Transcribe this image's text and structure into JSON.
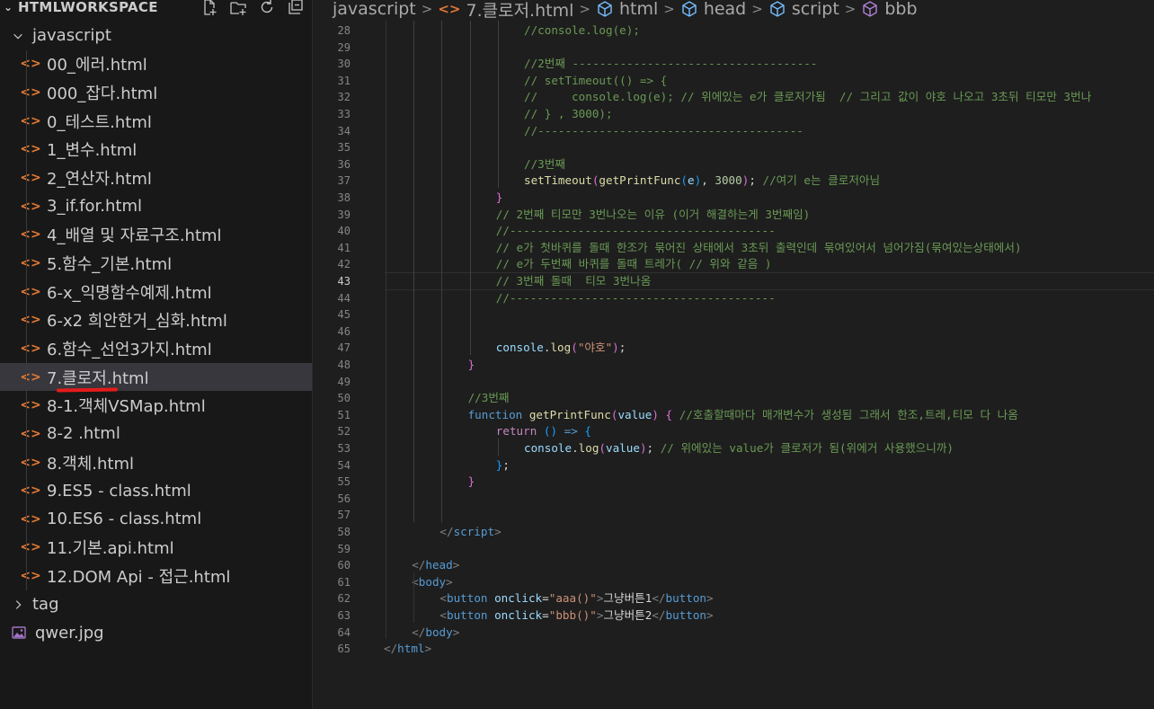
{
  "explorer": {
    "title": "HTMLWORKSPACE",
    "actions": [
      "new-file-icon",
      "new-folder-icon",
      "refresh-icon",
      "collapse-all-icon"
    ],
    "folder_open": "javascript",
    "files": [
      "00_에러.html",
      "000_잡다.html",
      "0_테스트.html",
      "1_변수.html",
      "2_연산자.html",
      "3_if.for.html",
      "4_배열 및 자료구조.html",
      "5.함수_기본.html",
      "6-x_익명함수예제.html",
      "6-x2 희안한거_심화.html",
      "6.함수_선언3가지.html",
      "7.클로저.html",
      "8-1.객체VSMap.html",
      "8-2 .html",
      "8.객체.html",
      "9.ES5 - class.html",
      "10.ES6 - class.html",
      "11.기본.api.html",
      "12.DOM Api - 접근.html"
    ],
    "selected_file": "7.클로저.html",
    "folder_closed": "tag",
    "image_file": "qwer.jpg"
  },
  "breadcrumb": {
    "items": [
      "javascript",
      "7.클로저.html",
      "html",
      "head",
      "script",
      "bbb"
    ]
  },
  "editor": {
    "active_line": "43",
    "lines": [
      {
        "n": "28",
        "t": [
          [
            "//console.log(e);",
            "com"
          ]
        ]
      },
      {
        "n": "29",
        "t": []
      },
      {
        "n": "30",
        "t": [
          [
            "//2번째 ------------------------------------",
            "com"
          ]
        ]
      },
      {
        "n": "31",
        "t": [
          [
            "// setTimeout(() => {",
            "com"
          ]
        ]
      },
      {
        "n": "32",
        "t": [
          [
            "//     console.log(e); // 위에있는 e가 클로저가됨  // 그리고 값이 야호 나오고 3초뒤 티모만 3번나",
            "com"
          ]
        ]
      },
      {
        "n": "33",
        "t": [
          [
            "// } , 3000);",
            "com"
          ]
        ]
      },
      {
        "n": "34",
        "t": [
          [
            "//---------------------------------------",
            "com"
          ]
        ]
      },
      {
        "n": "35",
        "t": []
      },
      {
        "n": "36",
        "t": [
          [
            "//3번째",
            "com"
          ]
        ]
      },
      {
        "n": "37",
        "t": [
          [
            "setTimeout",
            "fn"
          ],
          [
            "(",
            "p1"
          ],
          [
            "getPrintFunc",
            "fn"
          ],
          [
            "(",
            "p2"
          ],
          [
            "e",
            "var"
          ],
          [
            ")",
            "p2"
          ],
          [
            ", ",
            "txt"
          ],
          [
            "3000",
            "num"
          ],
          [
            ")",
            "p1"
          ],
          [
            "; ",
            "txt"
          ],
          [
            "//여기 e는 클로저아님",
            "com"
          ]
        ]
      },
      {
        "n": "38",
        "t": [
          [
            "}",
            "p1"
          ]
        ]
      },
      {
        "n": "39",
        "t": [
          [
            "// 2번째 티모만 3번나오는 이유 (이거 해결하는게 3번째임)",
            "com"
          ]
        ]
      },
      {
        "n": "40",
        "t": [
          [
            "//---------------------------------------",
            "com"
          ]
        ]
      },
      {
        "n": "41",
        "t": [
          [
            "// e가 첫바퀴를 돌때 한조가 묶어진 상태에서 3초뒤 출력인데 묶여있어서 넘어가짐(묶여있는상태에서)",
            "com"
          ]
        ]
      },
      {
        "n": "42",
        "t": [
          [
            "// e가 두번째 바퀴를 돌때 트레가( // 위와 같음 )",
            "com"
          ]
        ]
      },
      {
        "n": "43",
        "t": [
          [
            "// 3번째 돌때  티모 3번나옴",
            "com"
          ]
        ]
      },
      {
        "n": "44",
        "t": [
          [
            "//---------------------------------------",
            "com"
          ]
        ]
      },
      {
        "n": "45",
        "t": []
      },
      {
        "n": "46",
        "t": []
      },
      {
        "n": "47",
        "t": [
          [
            "console",
            "var"
          ],
          [
            ".",
            "txt"
          ],
          [
            "log",
            "fn"
          ],
          [
            "(",
            "p1"
          ],
          [
            "\"야호\"",
            "str"
          ],
          [
            ")",
            "p1"
          ],
          [
            ";",
            "txt"
          ]
        ]
      },
      {
        "n": "48",
        "t": [
          [
            "}",
            "p1"
          ]
        ]
      },
      {
        "n": "49",
        "t": []
      },
      {
        "n": "50",
        "t": [
          [
            "//3번째",
            "com"
          ]
        ]
      },
      {
        "n": "51",
        "t": [
          [
            "function ",
            "kw"
          ],
          [
            "getPrintFunc",
            "fn"
          ],
          [
            "(",
            "p1"
          ],
          [
            "value",
            "var"
          ],
          [
            ")",
            "p1"
          ],
          [
            " ",
            "txt"
          ],
          [
            "{",
            "p1"
          ],
          [
            " ",
            "txt"
          ],
          [
            "//호출할때마다 매개변수가 생성됨 그래서 한조,트레,티모 다 나옴",
            "com"
          ]
        ]
      },
      {
        "n": "52",
        "t": [
          [
            "return ",
            "ctl"
          ],
          [
            "()",
            "p2"
          ],
          [
            " => ",
            "kw"
          ],
          [
            "{",
            "p2"
          ]
        ]
      },
      {
        "n": "53",
        "t": [
          [
            "console",
            "var"
          ],
          [
            ".",
            "txt"
          ],
          [
            "log",
            "fn"
          ],
          [
            "(",
            "p1"
          ],
          [
            "value",
            "var"
          ],
          [
            ")",
            "p1"
          ],
          [
            "; ",
            "txt"
          ],
          [
            "// 위에있는 value가 클로저가 됨(위에거 사용했으니까)",
            "com"
          ]
        ]
      },
      {
        "n": "54",
        "t": [
          [
            "}",
            "p2"
          ],
          [
            ";",
            "txt"
          ]
        ]
      },
      {
        "n": "55",
        "t": [
          [
            "}",
            "p1"
          ]
        ]
      },
      {
        "n": "56",
        "t": []
      },
      {
        "n": "57",
        "t": []
      },
      {
        "n": "58",
        "t": [
          [
            "</",
            "br"
          ],
          [
            "script",
            "tag"
          ],
          [
            ">",
            "br"
          ]
        ]
      },
      {
        "n": "59",
        "t": []
      },
      {
        "n": "60",
        "t": [
          [
            "</",
            "br"
          ],
          [
            "head",
            "tag"
          ],
          [
            ">",
            "br"
          ]
        ]
      },
      {
        "n": "61",
        "t": [
          [
            "<",
            "br"
          ],
          [
            "body",
            "tag"
          ],
          [
            ">",
            "br"
          ]
        ]
      },
      {
        "n": "62",
        "t": [
          [
            "<",
            "br"
          ],
          [
            "button ",
            "tag"
          ],
          [
            "onclick",
            "attr"
          ],
          [
            "=",
            "txt"
          ],
          [
            "\"aaa()\"",
            "str"
          ],
          [
            ">",
            "br"
          ],
          [
            "그냥버튼1",
            "txt"
          ],
          [
            "</",
            "br"
          ],
          [
            "button",
            "tag"
          ],
          [
            ">",
            "br"
          ]
        ]
      },
      {
        "n": "63",
        "t": [
          [
            "<",
            "br"
          ],
          [
            "button ",
            "tag"
          ],
          [
            "onclick",
            "attr"
          ],
          [
            "=",
            "txt"
          ],
          [
            "\"bbb()\"",
            "str"
          ],
          [
            ">",
            "br"
          ],
          [
            "그냥버튼2",
            "txt"
          ],
          [
            "</",
            "br"
          ],
          [
            "button",
            "tag"
          ],
          [
            ">",
            "br"
          ]
        ]
      },
      {
        "n": "64",
        "t": [
          [
            "</",
            "br"
          ],
          [
            "body",
            "tag"
          ],
          [
            ">",
            "br"
          ]
        ]
      },
      {
        "n": "65",
        "t": [
          [
            "</",
            "br"
          ],
          [
            "html",
            "tag"
          ],
          [
            ">",
            "br"
          ]
        ]
      }
    ]
  },
  "colors": {
    "editor_bg": "#1e1e1e",
    "sidebar_bg": "#181818",
    "selection_bg": "#37373d",
    "html_icon": "#e37933",
    "annotation_underline": "#e51b1b"
  }
}
